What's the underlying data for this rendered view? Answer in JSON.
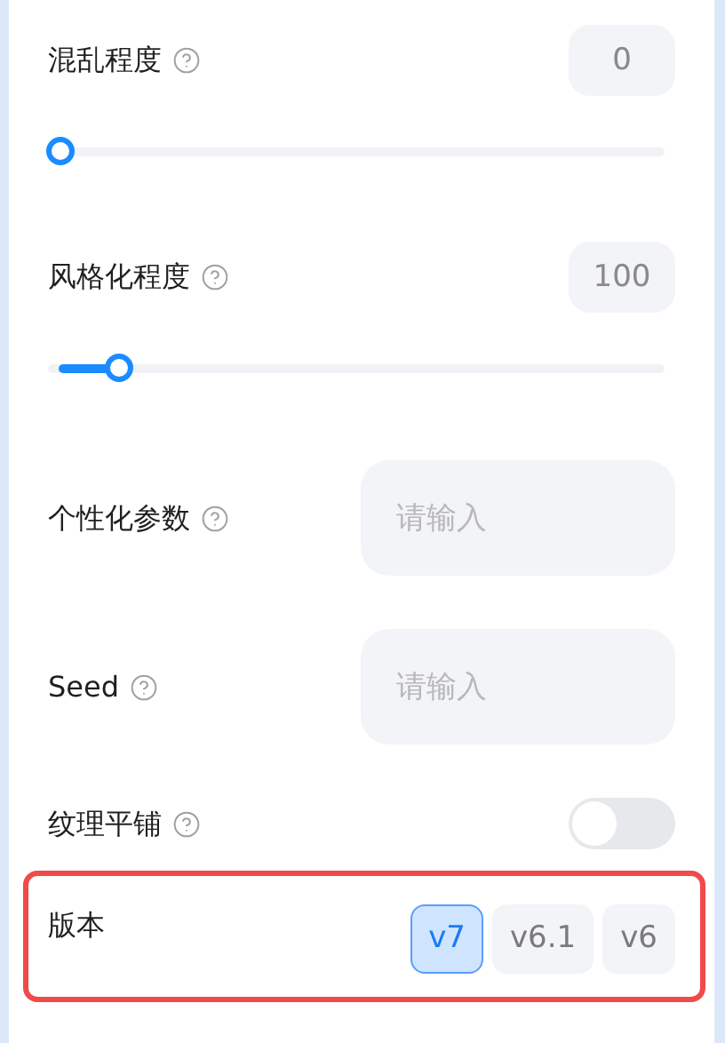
{
  "settings": [
    {
      "kind": "slider",
      "label": "混乱程度",
      "help": true,
      "value": "0",
      "level": 0
    },
    {
      "kind": "slider",
      "label": "风格化程度",
      "help": true,
      "value": "100",
      "level": 0.1
    },
    {
      "kind": "text",
      "label": "个性化参数",
      "help": true,
      "placeholder": "请输入"
    },
    {
      "kind": "text",
      "label": "Seed",
      "help": true,
      "placeholder": "请输入"
    },
    {
      "kind": "toggle",
      "label": "纹理平铺",
      "help": true,
      "on": false
    },
    {
      "kind": "choice",
      "label": "版本",
      "help": false,
      "highlighted": true,
      "options": [
        {
          "label": "v7",
          "selected": true
        },
        {
          "label": "v6.1",
          "selected": false
        },
        {
          "label": "v6",
          "selected": false
        }
      ]
    }
  ]
}
